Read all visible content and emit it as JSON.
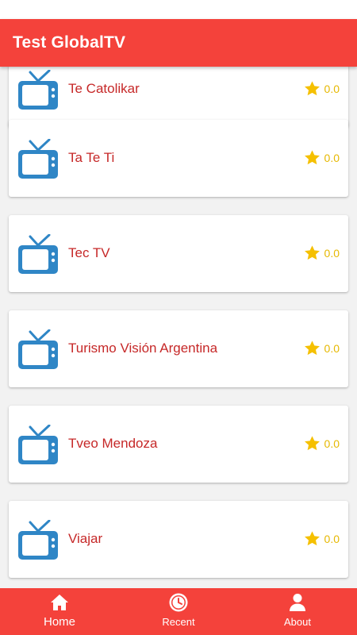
{
  "app_bar": {
    "title": "Test GlobalTV",
    "color": "#f4423b"
  },
  "channels": [
    {
      "name": "Te Catolikar",
      "rating": "0.0",
      "icon": "tv-icon"
    },
    {
      "name": "Ta Te Ti",
      "rating": "0.0",
      "icon": "tv-icon"
    },
    {
      "name": "Tec TV",
      "rating": "0.0",
      "icon": "tv-icon"
    },
    {
      "name": "Turismo Visión Argentina",
      "rating": "0.0",
      "icon": "tv-icon"
    },
    {
      "name": "Tveo Mendoza",
      "rating": "0.0",
      "icon": "tv-icon"
    },
    {
      "name": "Viajar",
      "rating": "0.0",
      "icon": "tv-icon"
    }
  ],
  "colors": {
    "channel_name": "#c62828",
    "star": "#f5c000",
    "tv_icon": "#2f86c6"
  },
  "bottom_nav": {
    "items": [
      {
        "label": "Home",
        "icon": "home-icon",
        "active": true
      },
      {
        "label": "Recent",
        "icon": "clock-icon",
        "active": false
      },
      {
        "label": "About",
        "icon": "person-icon",
        "active": false
      }
    ]
  }
}
